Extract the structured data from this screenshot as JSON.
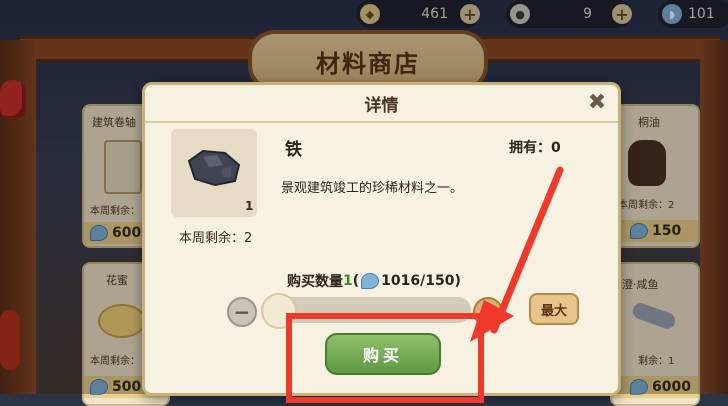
{
  "resources": [
    {
      "icon": "coin-icon",
      "value": "461"
    },
    {
      "icon": "gear-coin-icon",
      "value": "9"
    },
    {
      "icon": "shell-icon",
      "value": "101"
    }
  ],
  "shop": {
    "title": "材料商店"
  },
  "cards": [
    {
      "name": "建筑卷轴",
      "remain": "本周剩余：",
      "price": "600"
    },
    {
      "name": "花蜜",
      "remain": "本周剩余：",
      "price": "500"
    },
    {
      "name": "桐油",
      "remain": "本周剩余：2",
      "price": "150"
    },
    {
      "name": "澄·咸鱼",
      "remain": "剩余：1",
      "price": "6000"
    }
  ],
  "modal": {
    "title": "详情",
    "close": "✖",
    "item_name": "铁",
    "owned": "拥有：0",
    "description": "景观建筑竣工的珍稀材料之一。",
    "item_count": "1",
    "remaining_week": "本周剩余：2",
    "qty_label": "购买数量",
    "qty_value": "1",
    "qty_paren_open": " (",
    "qty_cost": "1016/150)",
    "minus": "−",
    "plus": "+",
    "max": "最大",
    "buy": "购买"
  },
  "colors": {
    "accent_green": "#5f9a43",
    "annotation_red": "#f0392b"
  }
}
